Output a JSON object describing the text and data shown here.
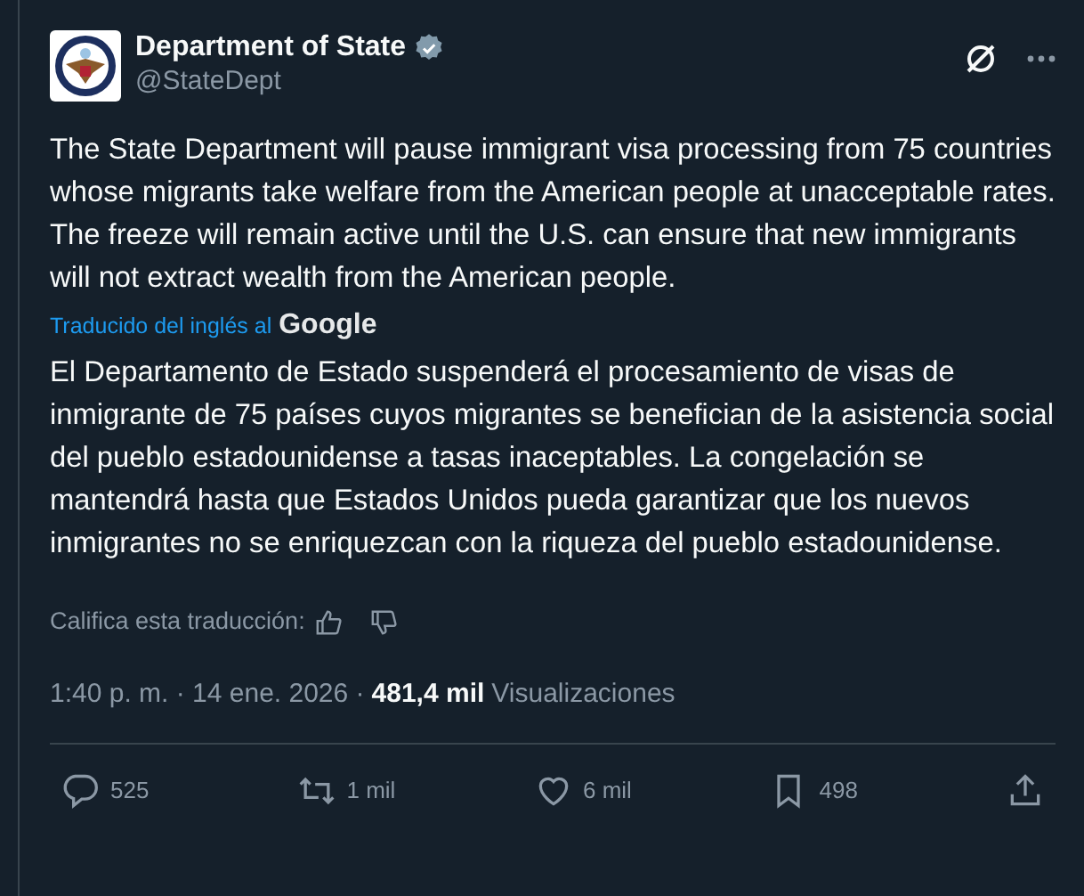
{
  "author": {
    "name": "Department of State",
    "handle": "@StateDept",
    "verified": true
  },
  "original_text": "The State Department will pause immigrant visa processing from 75 countries whose migrants take welfare from the American people at unacceptable rates. The freeze will remain active until the U.S. can ensure that new immigrants will not extract wealth from the American people.",
  "translation_note": {
    "label": "Traducido del inglés al",
    "provider": "Google"
  },
  "translated_text": "El Departamento de Estado suspenderá el procesamiento de visas de inmigrante de 75 países cuyos migrantes se benefician de la asistencia social del pueblo estadounidense a tasas inaceptables. La congelación se mantendrá hasta que Estados Unidos pueda garantizar que los nuevos inmigrantes no se enriquezcan con la riqueza del pueblo estadounidense.",
  "rate_prompt": "Califica esta traducción:",
  "timestamp": "1:40 p. m. · 14 ene. 2026 ·",
  "views": {
    "count": "481,4 mil",
    "label": "Visualizaciones"
  },
  "actions": [
    {
      "kind": "reply",
      "count": "525"
    },
    {
      "kind": "repost",
      "count": "1 mil"
    },
    {
      "kind": "like",
      "count": "6 mil"
    },
    {
      "kind": "bookmark",
      "count": "498"
    },
    {
      "kind": "share"
    }
  ]
}
